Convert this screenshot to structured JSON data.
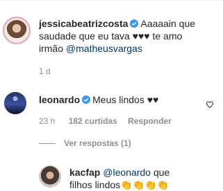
{
  "comments": [
    {
      "username": "jessicabeatrizcosta",
      "verified": true,
      "text_line1": "Aaaaain que",
      "text_line2": "saudade que eu tava ♥♥♥ te amo",
      "text_line3_prefix": "irmão ",
      "mention": "@matheusvargas",
      "time": "1 d"
    },
    {
      "username": "leonardo",
      "verified": true,
      "text": "Meus lindos ♥♥",
      "time": "23 h",
      "likes": "182 curtidas",
      "reply_label": "Responder",
      "view_replies": "Ver respostas (1)"
    }
  ],
  "reply": {
    "username": "kacfap",
    "mention": "@leonardo",
    "text_after_mention": " que",
    "text_line2": "filhos lindos👏👏👏👏"
  },
  "colors": {
    "verified": "#3897f0",
    "mention": "#00376b",
    "meta": "#8e8e8e"
  }
}
